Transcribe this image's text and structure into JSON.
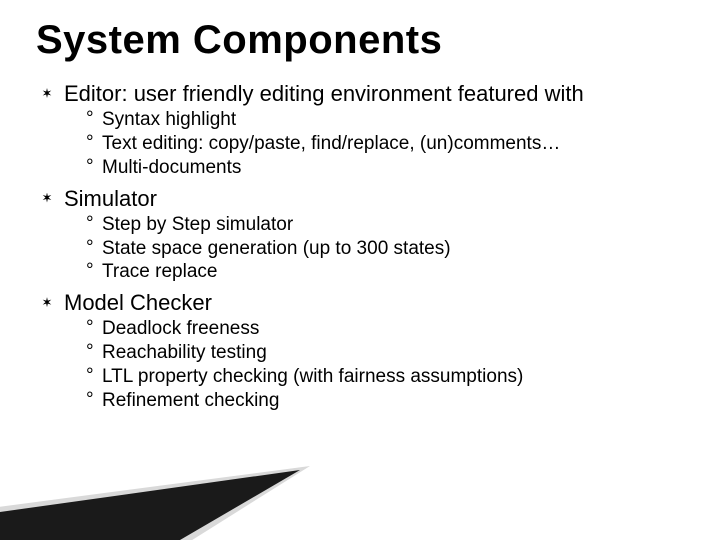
{
  "title": "System Components",
  "items": [
    {
      "label": "Editor: user friendly editing environment featured with",
      "sub": [
        "Syntax highlight",
        "Text editing: copy/paste, find/replace, (un)comments…",
        "Multi-documents"
      ]
    },
    {
      "label": "Simulator",
      "sub": [
        "Step by Step simulator",
        "State space generation (up to 300 states)",
        "Trace replace"
      ]
    },
    {
      "label": "Model Checker",
      "sub": [
        "Deadlock freeness",
        "Reachability testing",
        "LTL property checking (with fairness assumptions)",
        "Refinement checking"
      ]
    }
  ]
}
